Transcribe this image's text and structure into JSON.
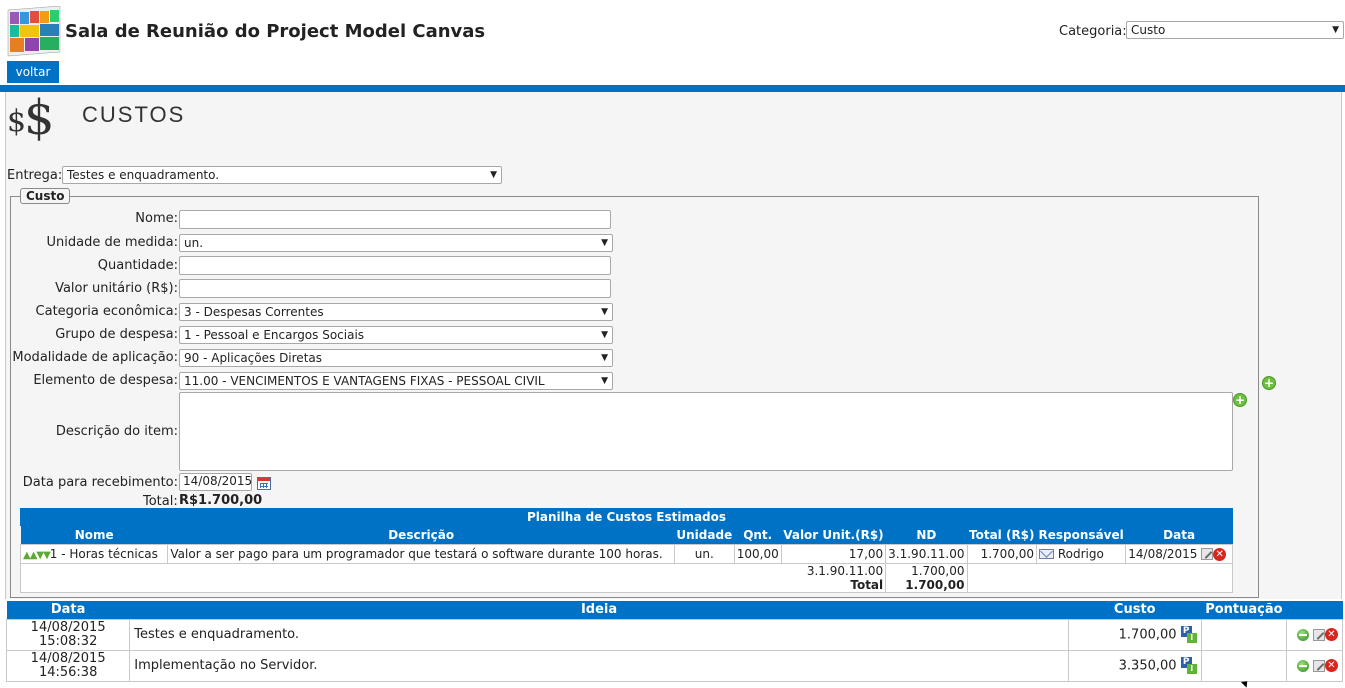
{
  "app": {
    "title": "Sala de Reunião do Project Model Canvas",
    "back_label": "voltar"
  },
  "header": {
    "categoria_label": "Categoria:",
    "categoria_value": "Custo"
  },
  "section": {
    "title": "CUSTOS",
    "icon": "dollar-icon"
  },
  "entrega": {
    "label": "Entrega:",
    "value": "Testes e enquadramento."
  },
  "form": {
    "legend": "Custo",
    "nome_label": "Nome:",
    "nome_value": "",
    "unidade_label": "Unidade de medida:",
    "unidade_value": "un.",
    "quantidade_label": "Quantidade:",
    "quantidade_value": "",
    "valor_label": "Valor unitário (R$):",
    "valor_value": "",
    "categoria_label": "Categoria econômica:",
    "categoria_value": "3 - Despesas Correntes",
    "grupo_label": "Grupo de despesa:",
    "grupo_value": "1 - Pessoal e Encargos Sociais",
    "modalidade_label": "Modalidade de aplicação:",
    "modalidade_value": "90 - Aplicações Diretas",
    "elemento_label": "Elemento de despesa:",
    "elemento_value": "11.00 - VENCIMENTOS E VANTAGENS FIXAS - PESSOAL CIVIL",
    "descricao_label": "Descrição do item:",
    "descricao_value": "",
    "data_label": "Data para recebimento:",
    "data_value": "14/08/2015",
    "total_label": "Total:",
    "total_value": "R$1.700,00"
  },
  "planilha": {
    "title": "Planilha de Custos Estimados",
    "columns": [
      "Nome",
      "Descrição",
      "Unidade",
      "Qnt.",
      "Valor Unit.(R$)",
      "ND",
      "Total (R$)",
      "Responsável",
      "Data"
    ],
    "row": {
      "arrows": "▲▲▼▼",
      "nome": "1 - Horas técnicas",
      "descricao": "Valor a ser pago para um programador que testará o software durante 100 horas.",
      "unidade": "un.",
      "qnt": "100,00",
      "valor_unit": "17,00",
      "nd": "3.1.90.11.00",
      "total": "1.700,00",
      "responsavel": "Rodrigo",
      "data": "14/08/2015"
    },
    "summary": {
      "nd": "3.1.90.11.00",
      "nd_total": "1.700,00",
      "total_label": "Total",
      "total_value": "1.700,00"
    }
  },
  "ideias": {
    "columns": [
      "Data",
      "Ideia",
      "Custo",
      "Pontuação"
    ],
    "rows": [
      {
        "date": "14/08/2015",
        "time": "15:08:32",
        "ideia": "Testes e enquadramento.",
        "custo": "1.700,00"
      },
      {
        "date": "14/08/2015",
        "time": "14:56:38",
        "ideia": "Implementação no Servidor.",
        "custo": "3.350,00"
      }
    ]
  },
  "colors": {
    "accent": "#0072c6",
    "panel": "#f5f5f5",
    "add_green": "#6fbf3f",
    "delete_red": "#d9261c"
  }
}
